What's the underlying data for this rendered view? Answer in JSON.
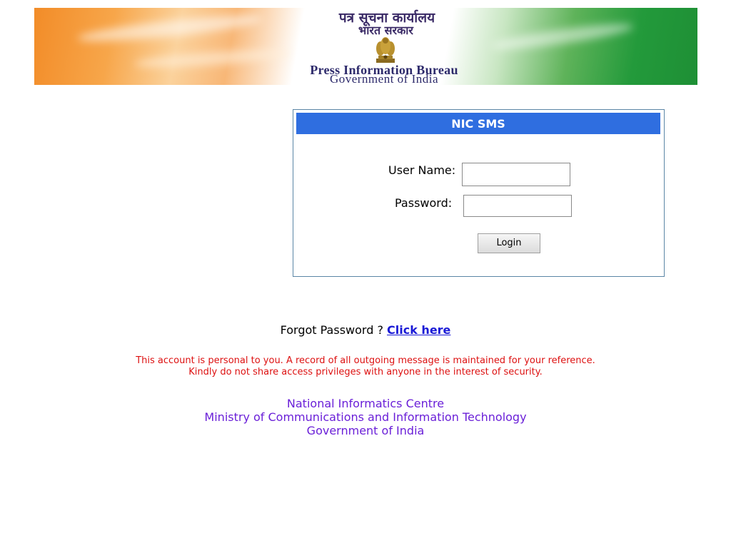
{
  "banner": {
    "hindi_title": "पत्र सूचना कार्यालय",
    "hindi_subtitle": "भारत सरकार",
    "title": "Press Information Bureau",
    "subtitle": "Government of India",
    "emblem_icon": "national-emblem-icon"
  },
  "login": {
    "header": "NIC SMS",
    "username_label": "User Name:",
    "username_value": "",
    "password_label": "Password:",
    "password_value": "",
    "login_button": "Login"
  },
  "forgot": {
    "text": "Forgot Password ? ",
    "link": "Click here"
  },
  "warning": {
    "line1": "This account is personal to you. A record of all outgoing message is maintained for your reference.",
    "line2": "Kindly do not share access privileges with anyone in the interest of security."
  },
  "footer": {
    "line1": "National Informatics Centre",
    "line2": "Ministry of Communications and Information Technology",
    "line3": "Government of India"
  },
  "colors": {
    "header_bg": "#2f6ee0",
    "warning_text": "#dd1111",
    "footer_text": "#6a1fd8",
    "link": "#1a1ad6"
  }
}
